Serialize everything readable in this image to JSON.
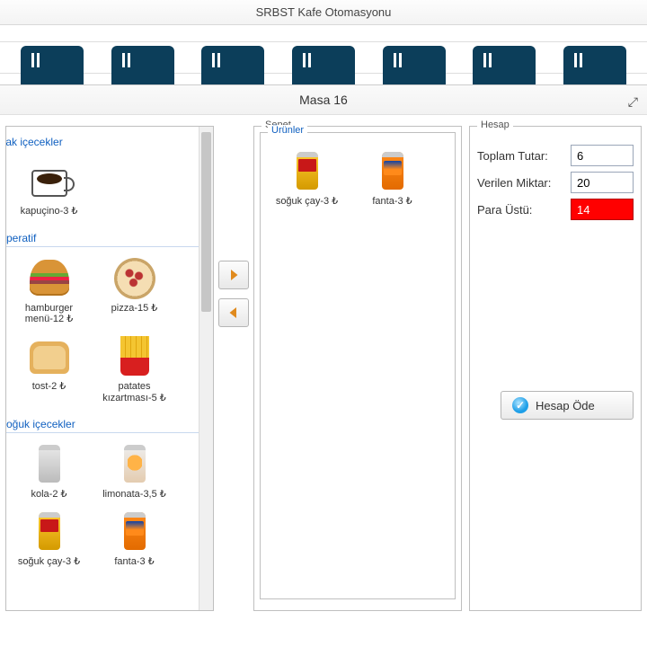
{
  "app_title": "SRBST Kafe Otomasyonu",
  "modal_title": "Masa 16",
  "categories": {
    "hot": "Sıcak içecekler",
    "apetite": "Aperatif",
    "cold": "Soğuk içecekler"
  },
  "products": {
    "macchiato": "kapuçino-3 ₺",
    "burger": "hamburger\nmenü-12 ₺",
    "pizza": "pizza-15 ₺",
    "toast": "tost-2 ₺",
    "fries": "patates\nkızartması-5 ₺",
    "cola": "kola-2 ₺",
    "limon": "limonata-3,5 ₺",
    "icetea": "soğuk çay-3 ₺",
    "fanta": "fanta-3 ₺"
  },
  "basket": {
    "legend": "Sepet",
    "sublegend": "Ürünler",
    "items": {
      "icetea": "soğuk çay-3 ₺",
      "fanta": "fanta-3 ₺"
    }
  },
  "hesap": {
    "legend": "Hesap",
    "total_label": "Toplam Tutar:",
    "total_value": "6",
    "given_label": "Verilen Miktar:",
    "given_value": "20",
    "change_label": "Para Üstü:",
    "change_value": "14",
    "pay_button": "Hesap Öde"
  }
}
